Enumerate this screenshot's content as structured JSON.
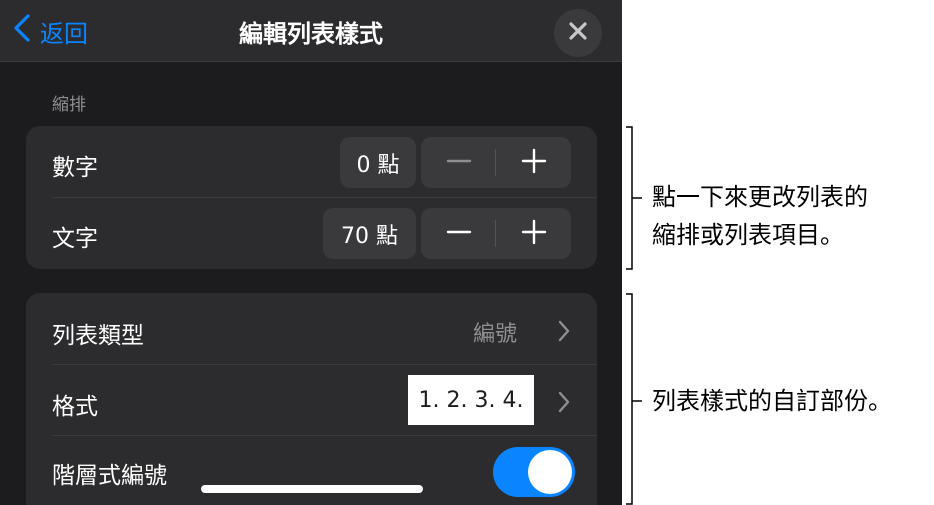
{
  "header": {
    "back_label": "返回",
    "title": "編輯列表樣式"
  },
  "indent": {
    "section_label": "縮排",
    "number_row": {
      "label": "數字",
      "value": "0 點"
    },
    "text_row": {
      "label": "文字",
      "value": "70 點"
    }
  },
  "list": {
    "type_row": {
      "label": "列表類型",
      "value": "編號"
    },
    "format_row": {
      "label": "格式",
      "value": "1. 2. 3. 4."
    },
    "tiered_row": {
      "label": "階層式編號",
      "toggle_on": true
    }
  },
  "callouts": {
    "indent_line1": "點一下來更改列表的",
    "indent_line2": "縮排或列表項目。",
    "custom": "列表樣式的自訂部份。"
  },
  "colors": {
    "accent": "#0a84ff",
    "panel_bg": "#1c1c1e",
    "group_bg": "#2c2c2e"
  }
}
